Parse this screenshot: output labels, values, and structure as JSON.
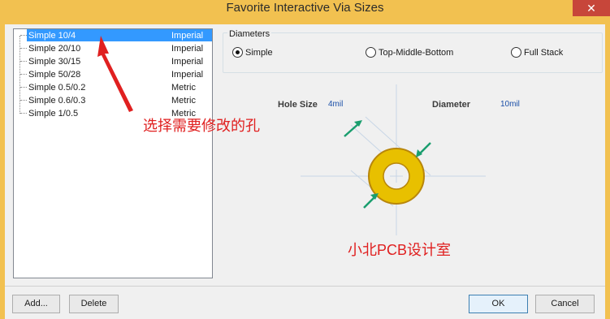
{
  "window": {
    "title": "Favorite Interactive Via Sizes",
    "close_glyph": "✕"
  },
  "via_list": [
    {
      "name": "Simple 10/4",
      "unit": "Imperial",
      "selected": true
    },
    {
      "name": "Simple 20/10",
      "unit": "Imperial",
      "selected": false
    },
    {
      "name": "Simple 30/15",
      "unit": "Imperial",
      "selected": false
    },
    {
      "name": "Simple 50/28",
      "unit": "Imperial",
      "selected": false
    },
    {
      "name": "Simple 0.5/0.2",
      "unit": "Metric",
      "selected": false
    },
    {
      "name": "Simple 0.6/0.3",
      "unit": "Metric",
      "selected": false
    },
    {
      "name": "Simple 1/0.5",
      "unit": "Metric",
      "selected": false
    }
  ],
  "diameters": {
    "group_label": "Diameters",
    "options": [
      {
        "label": "Simple",
        "checked": true
      },
      {
        "label": "Top-Middle-Bottom",
        "checked": false
      },
      {
        "label": "Full Stack",
        "checked": false
      }
    ]
  },
  "hole_size": {
    "label": "Hole Size",
    "value": "4mil"
  },
  "diameter": {
    "label": "Diameter",
    "value": "10mil"
  },
  "annotations": {
    "select_hole": "选择需要修改的孔",
    "watermark": "小北PCB设计室"
  },
  "buttons": {
    "add": "Add...",
    "delete": "Delete",
    "ok": "OK",
    "cancel": "Cancel"
  },
  "colors": {
    "title_bar": "#f2c150",
    "selection": "#3399ff",
    "pad_ring": "#e8c000",
    "pad_edge": "#b8860b",
    "dimension_arrow": "#1a9e6e",
    "annotation_red": "#e02020"
  }
}
